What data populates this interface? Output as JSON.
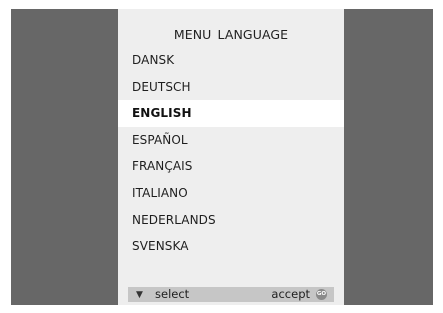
{
  "menu": {
    "title": "MENU  LANGUAGE",
    "selected_index": 2,
    "languages": [
      {
        "label": "DANSK"
      },
      {
        "label": "DEUTSCH"
      },
      {
        "label": "ENGLISH"
      },
      {
        "label": "ESPAÑOL"
      },
      {
        "label": "FRANÇAIS"
      },
      {
        "label": "ITALIANO"
      },
      {
        "label": "NEDERLANDS"
      },
      {
        "label": "SVENSKA"
      }
    ]
  },
  "status_bar": {
    "arrow_glyph": "▼",
    "select_label": "select",
    "accept_label": "accept",
    "go_button_text": "GO"
  },
  "colors": {
    "frame": "#676767",
    "panel": "#eeeeee",
    "highlight": "#ffffff",
    "status_bar": "#c6c6c6"
  }
}
